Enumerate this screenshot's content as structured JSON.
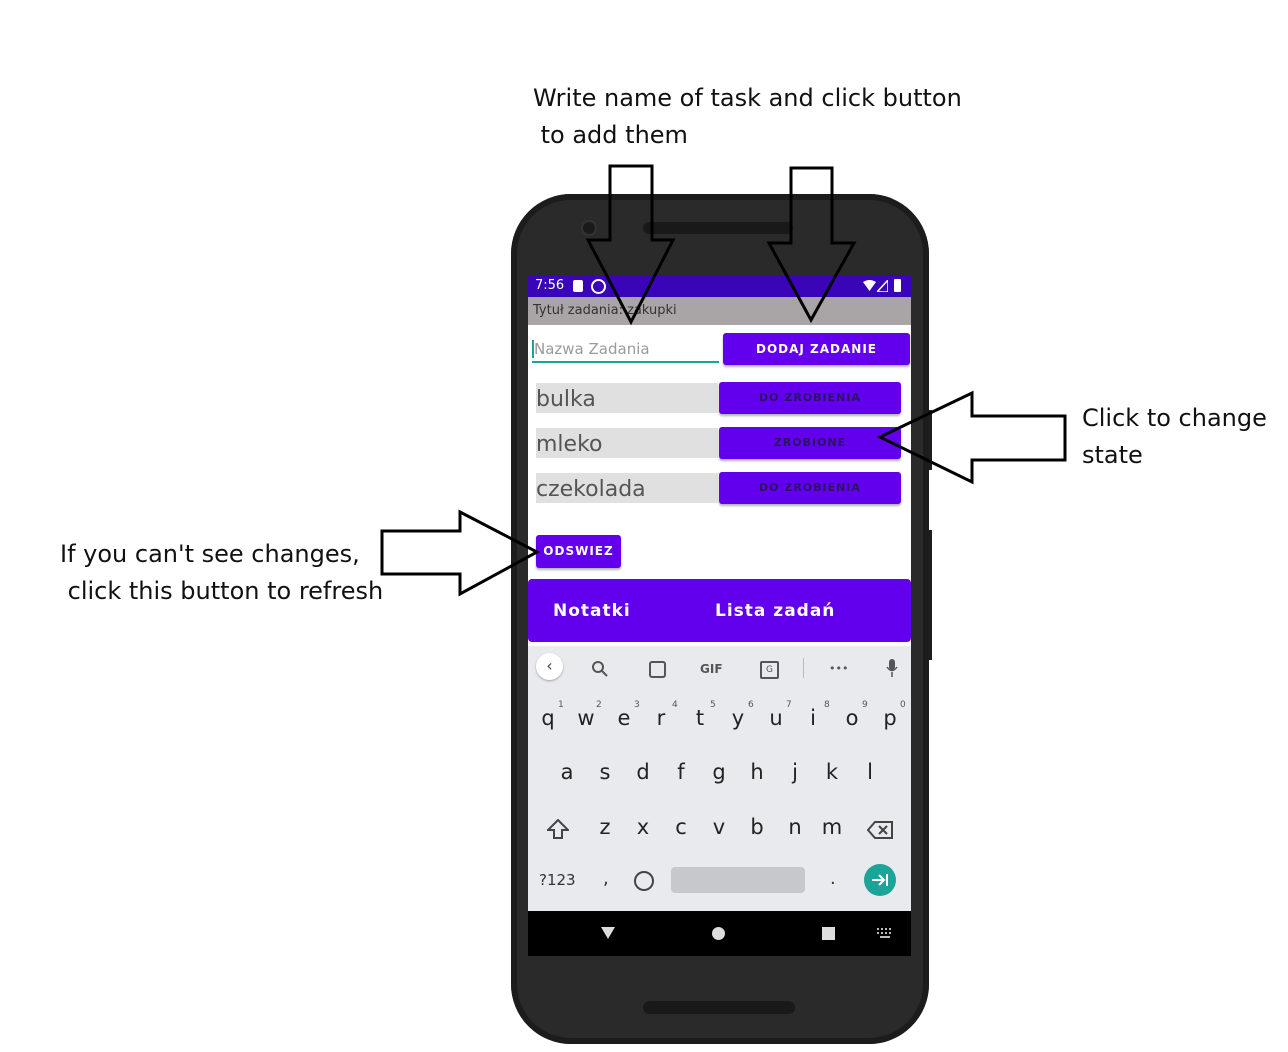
{
  "annotations": {
    "top_line1": "Write name of task and click button",
    "top_line2": " to add them",
    "right_line1": "Click to change",
    "right_line2": "state",
    "left_line1": "If you can't see changes,",
    "left_line2": " click this button to refresh"
  },
  "status_bar": {
    "time": "7:56"
  },
  "app": {
    "title": "Tytuł zadania: zakupki",
    "input_placeholder": "Nazwa Zadania",
    "add_button": "DODAJ ZADANIE",
    "tasks": [
      {
        "name": "bulka",
        "state": "DO ZROBIENIA"
      },
      {
        "name": "mleko",
        "state": "ZROBIONE"
      },
      {
        "name": "czekolada",
        "state": "DO ZROBIENIA"
      }
    ],
    "refresh_button": "ODSWIEZ",
    "bottom_nav": {
      "notes": "Notatki",
      "tasks": "Lista zadań"
    }
  },
  "keyboard": {
    "toolbar": {
      "gif": "GIF",
      "more": "•••"
    },
    "row1": [
      "q",
      "w",
      "e",
      "r",
      "t",
      "y",
      "u",
      "i",
      "o",
      "p"
    ],
    "row1_hints": [
      "1",
      "2",
      "3",
      "4",
      "5",
      "6",
      "7",
      "8",
      "9",
      "0"
    ],
    "row2": [
      "a",
      "s",
      "d",
      "f",
      "g",
      "h",
      "j",
      "k",
      "l"
    ],
    "row3": [
      "z",
      "x",
      "c",
      "v",
      "b",
      "n",
      "m"
    ],
    "symbols_key": "?123",
    "comma_key": ",",
    "period_key": "."
  }
}
